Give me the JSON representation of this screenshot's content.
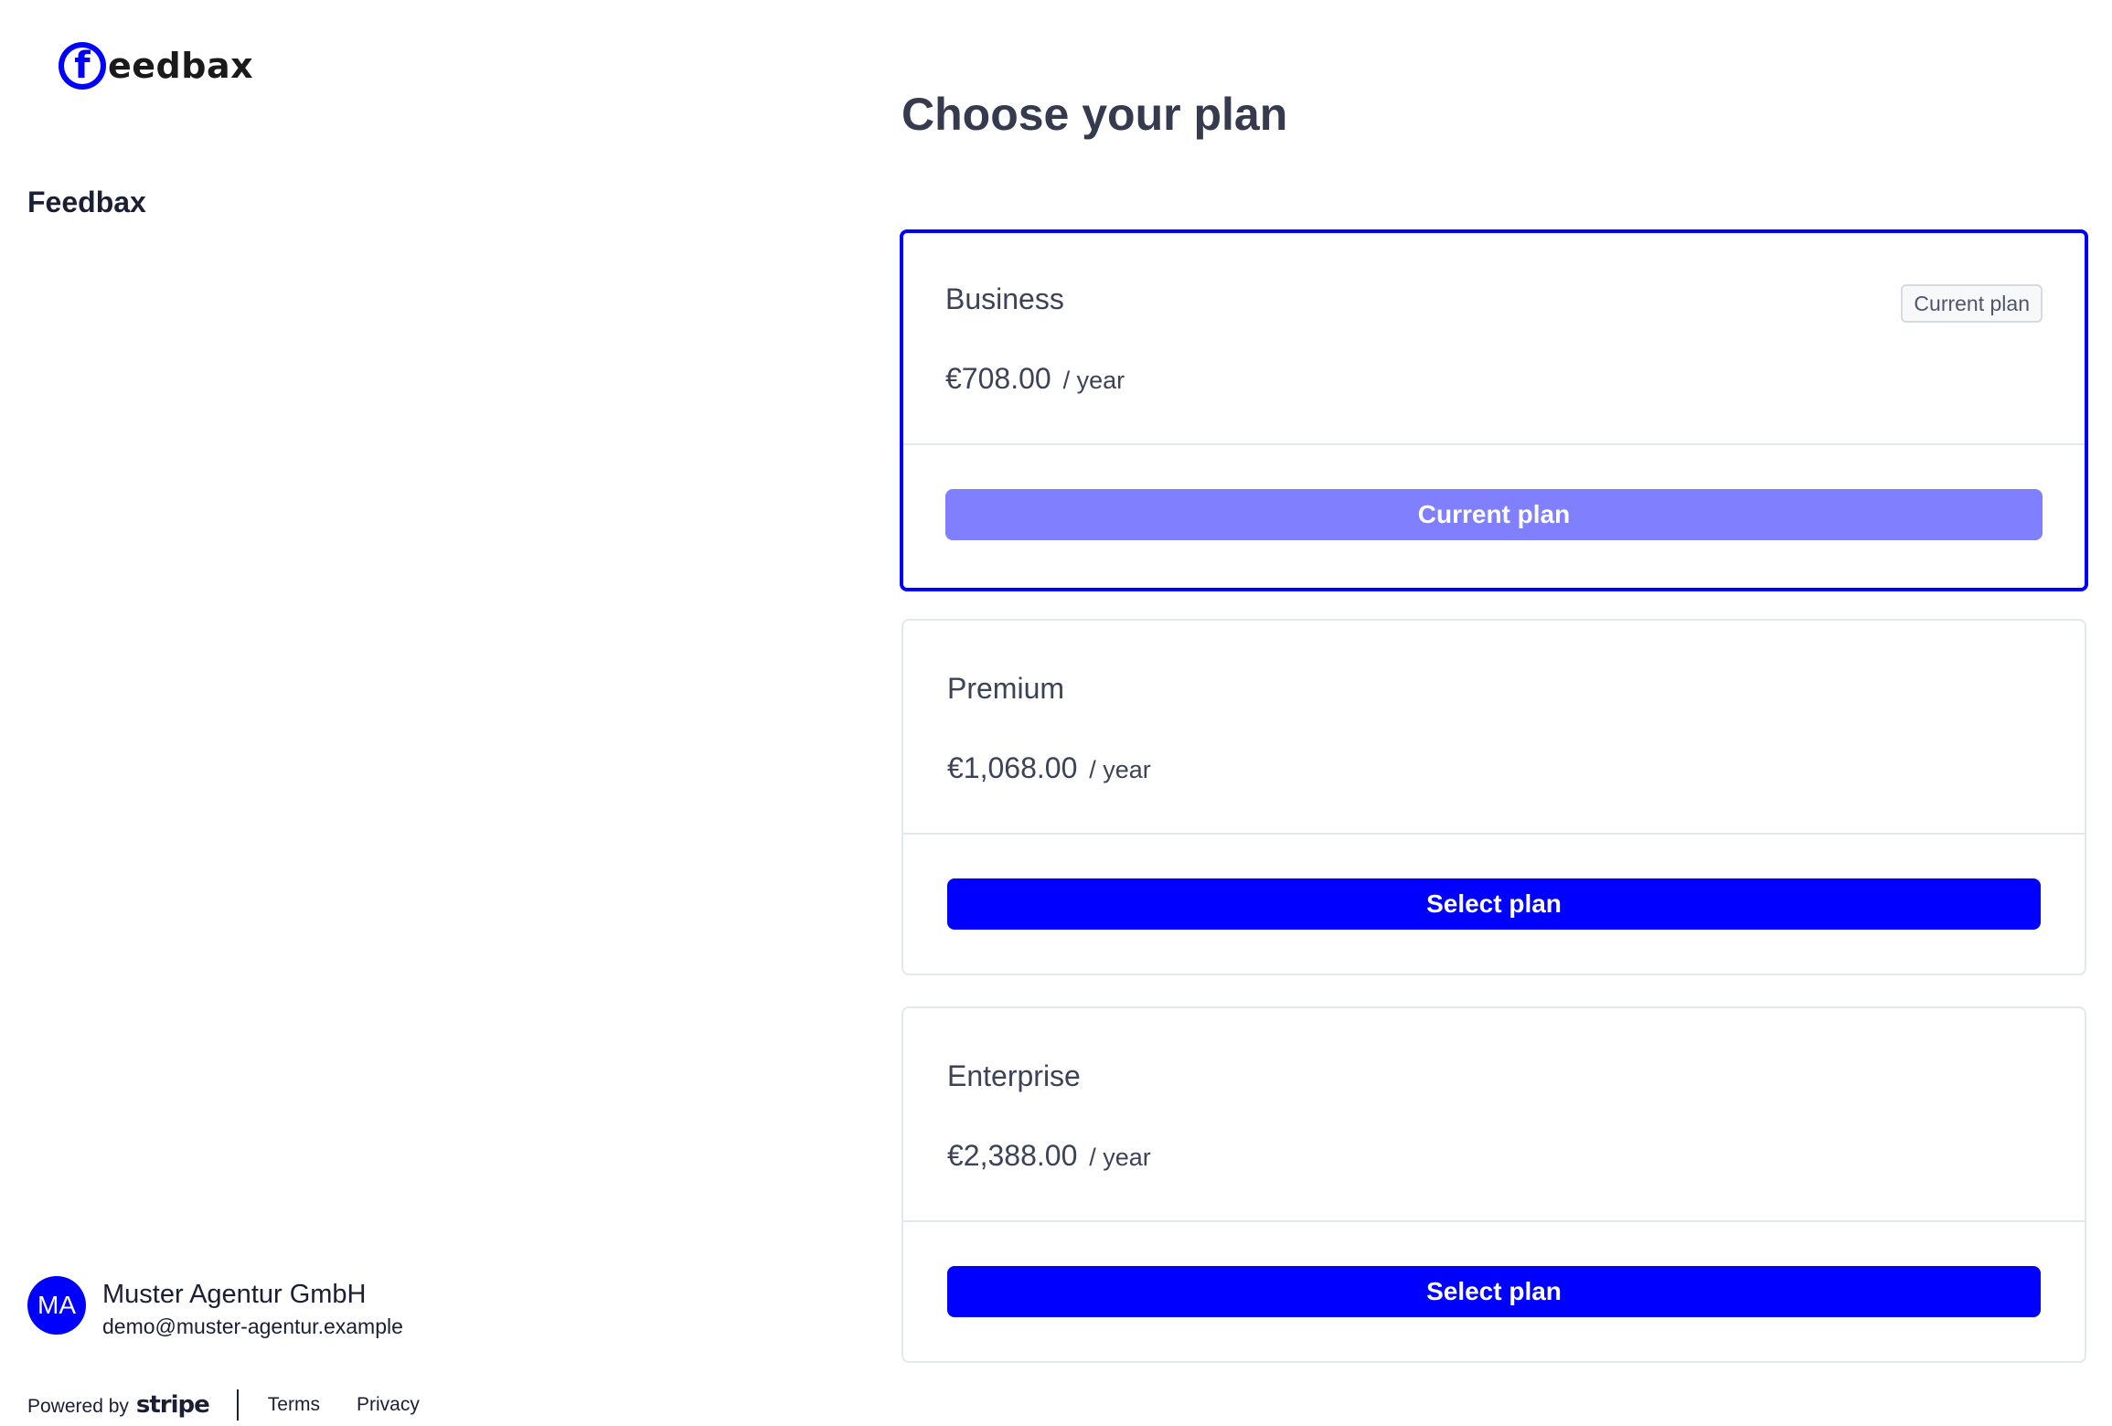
{
  "brand": {
    "logo_text": "eedbax",
    "logo_icon": "feedbax-f-logo",
    "accent_color": "#0000ff"
  },
  "sidebar": {
    "account_name": "Feedbax"
  },
  "customer": {
    "initials": "MA",
    "name": "Muster Agentur GmbH",
    "email": "demo@muster-agentur.example"
  },
  "footer": {
    "powered_by": "Powered by",
    "stripe": "stripe",
    "terms": "Terms",
    "privacy": "Privacy"
  },
  "main": {
    "title": "Choose your plan",
    "plans": [
      {
        "name": "Business",
        "price": "€708.00",
        "period": "/ year",
        "badge": "Current plan",
        "button": "Current plan",
        "current": true
      },
      {
        "name": "Premium",
        "price": "€1,068.00",
        "period": "/ year",
        "button": "Select plan",
        "current": false
      },
      {
        "name": "Enterprise",
        "price": "€2,388.00",
        "period": "/ year",
        "button": "Select plan",
        "current": false
      }
    ]
  }
}
